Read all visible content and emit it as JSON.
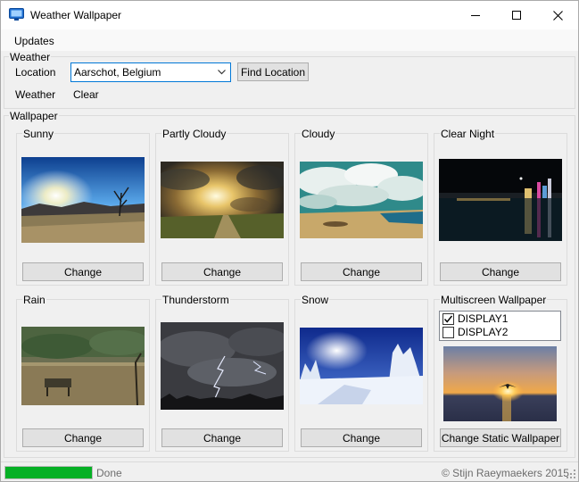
{
  "window": {
    "title": "Weather Wallpaper",
    "controls": [
      "minimize-icon",
      "maximize-icon",
      "close-icon"
    ]
  },
  "menu": {
    "updates": "Updates"
  },
  "weather_group": {
    "label": "Weather",
    "location_label": "Location",
    "location_value": "Aarschot, Belgium",
    "find_button": "Find Location",
    "weather_label": "Weather",
    "weather_value": "Clear"
  },
  "wallpaper_group": {
    "label": "Wallpaper",
    "panels": [
      {
        "title": "Sunny",
        "button": "Change"
      },
      {
        "title": "Partly Cloudy",
        "button": "Change"
      },
      {
        "title": "Cloudy",
        "button": "Change"
      },
      {
        "title": "Clear Night",
        "button": "Change"
      },
      {
        "title": "Rain",
        "button": "Change"
      },
      {
        "title": "Thunderstorm",
        "button": "Change"
      },
      {
        "title": "Snow",
        "button": "Change"
      }
    ],
    "multiscreen": {
      "title": "Multiscreen Wallpaper",
      "displays": [
        {
          "label": "DISPLAY1",
          "checked": true
        },
        {
          "label": "DISPLAY2",
          "checked": false
        }
      ],
      "button": "Change Static Wallpaper"
    }
  },
  "status": {
    "progress_percent": 100,
    "progress_color": "#06b025",
    "text": "Done",
    "copyright": "© Stijn Raeymaekers 2015"
  }
}
